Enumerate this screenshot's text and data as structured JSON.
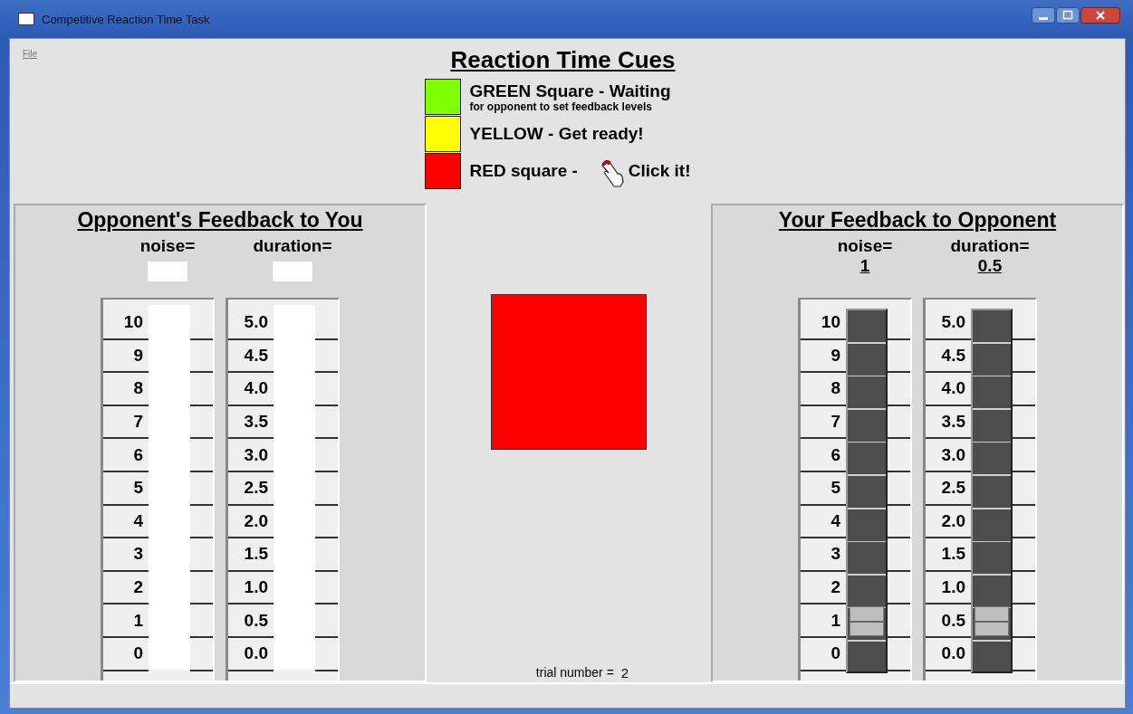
{
  "window": {
    "title": "Competitive Reaction Time Task"
  },
  "menu": [
    "File"
  ],
  "cues": {
    "title": "Reaction Time Cues",
    "items": [
      {
        "color": "#80ff00",
        "label": "GREEN Square - Waiting",
        "note": "for opponent to set feedback levels"
      },
      {
        "color": "#ffff00",
        "label": "YELLOW -  Get ready!"
      },
      {
        "color": "#ff0000",
        "label": "RED square  -",
        "action": "Click it!"
      }
    ]
  },
  "panels": [
    {
      "kind": "display",
      "title": "Opponent's Feedback to You",
      "scales": [
        {
          "label": "noise=",
          "ticks": [
            "10",
            "9",
            "8",
            "7",
            "6",
            "5",
            "4",
            "3",
            "2",
            "1",
            "0"
          ]
        },
        {
          "label": "duration=",
          "ticks": [
            "5.0",
            "4.5",
            "4.0",
            "3.5",
            "3.0",
            "2.5",
            "2.0",
            "1.5",
            "1.0",
            "0.5",
            "0.0"
          ]
        }
      ]
    },
    {
      "kind": "slider",
      "title": "Your Feedback to Opponent",
      "scales": [
        {
          "label": "noise=",
          "value": "1",
          "level": 0.1,
          "ticks": [
            "10",
            "9",
            "8",
            "7",
            "6",
            "5",
            "4",
            "3",
            "2",
            "1",
            "0"
          ]
        },
        {
          "label": "duration=",
          "value": "0.5",
          "level": 0.1,
          "ticks": [
            "5.0",
            "4.5",
            "4.0",
            "3.5",
            "3.0",
            "2.5",
            "2.0",
            "1.5",
            "1.0",
            "0.5",
            "0.0"
          ]
        }
      ]
    }
  ],
  "stimulus": {
    "color": "#ff0000"
  },
  "trial": {
    "label": "trial number =",
    "value": "2"
  }
}
